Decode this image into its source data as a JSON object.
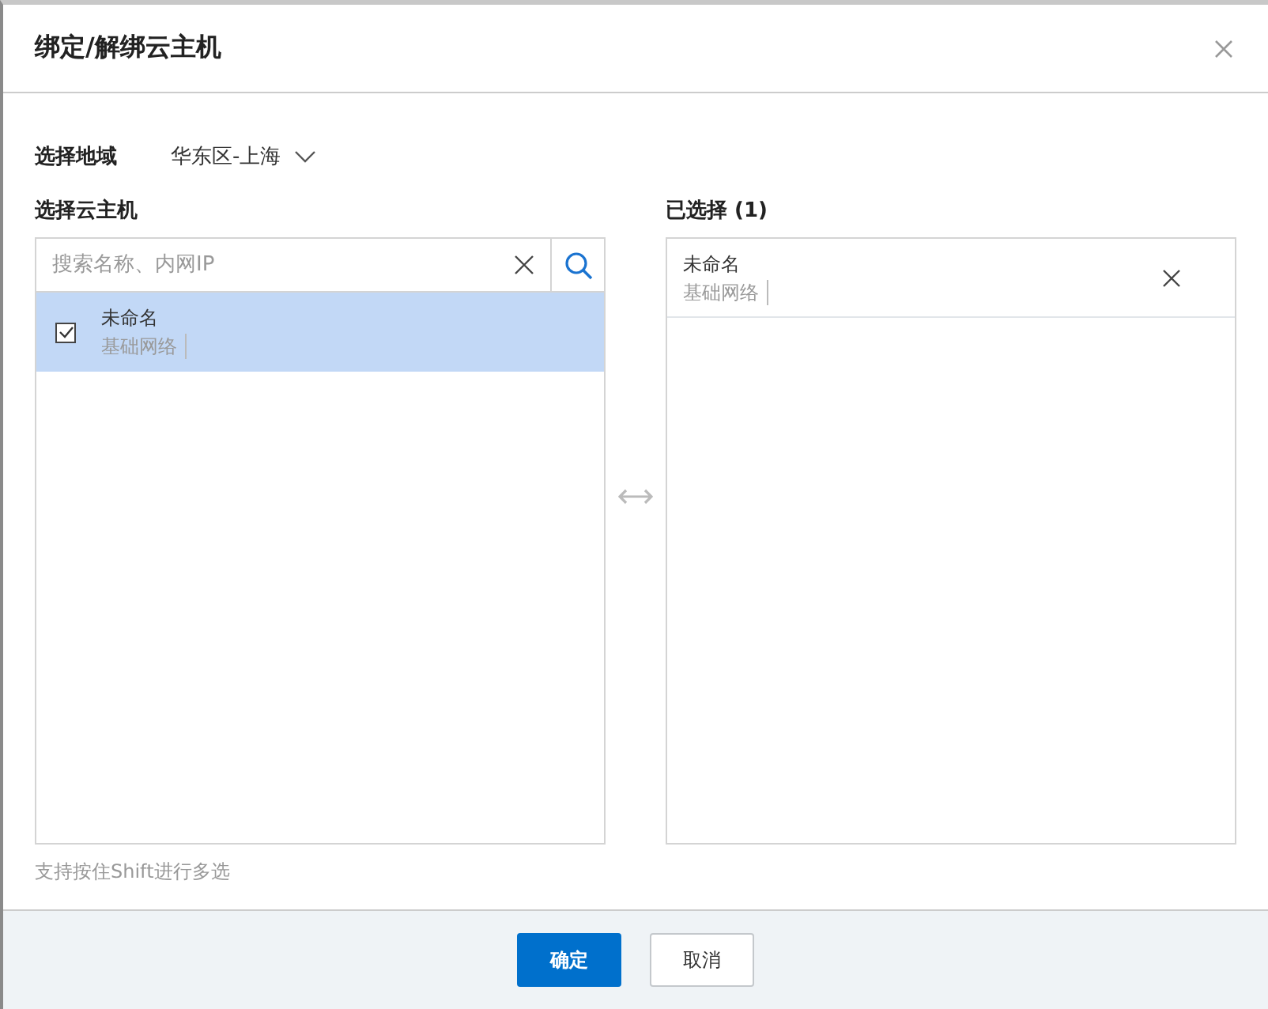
{
  "dialog": {
    "title": "绑定/解绑云主机"
  },
  "region": {
    "label": "选择地域",
    "value": "华东区-上海"
  },
  "available": {
    "label": "选择云主机",
    "search": {
      "placeholder": "搜索名称、内网IP"
    },
    "items": [
      {
        "name": "未命名",
        "network": "基础网络",
        "checked": true,
        "selected": true
      }
    ]
  },
  "chosen": {
    "label": "已选择 (1)",
    "items": [
      {
        "name": "未命名",
        "network": "基础网络"
      }
    ]
  },
  "hint": "支持按住Shift进行多选",
  "buttons": [
    {
      "label": "确定",
      "kind": "primary"
    },
    {
      "label": "取消",
      "kind": "default"
    }
  ]
}
